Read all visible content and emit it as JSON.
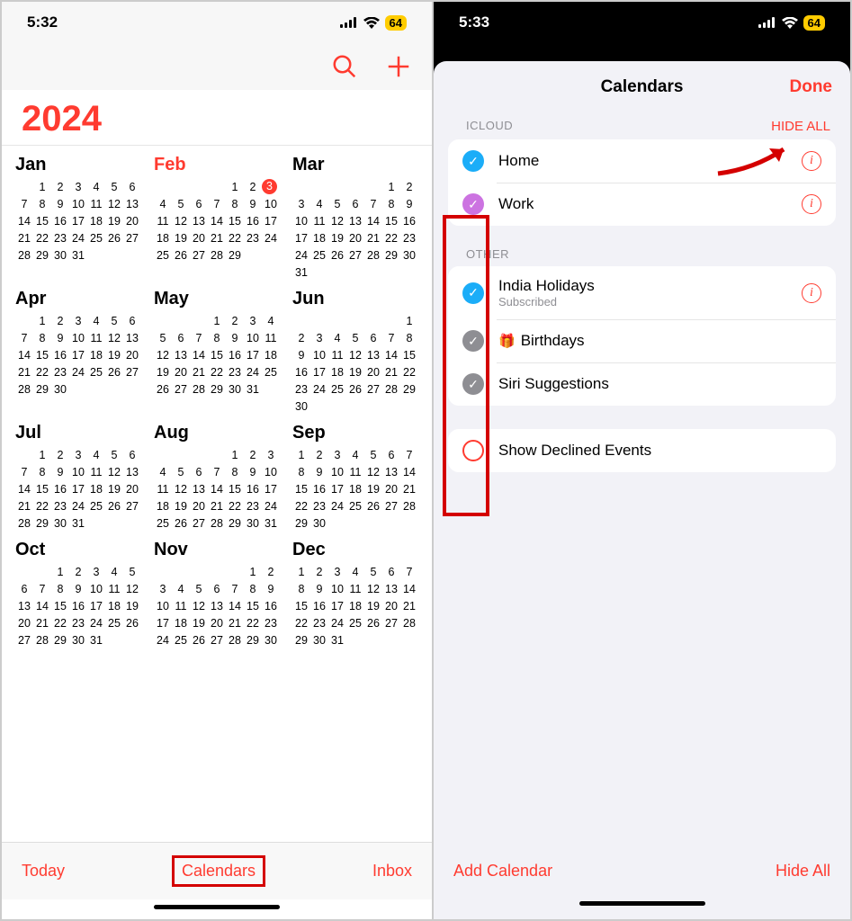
{
  "left": {
    "status": {
      "time": "5:32",
      "battery": "64"
    },
    "year": "2024",
    "months": [
      {
        "name": "Jan",
        "start": 1,
        "days": 31
      },
      {
        "name": "Feb",
        "start": 4,
        "days": 29,
        "current": true,
        "today": 3
      },
      {
        "name": "Mar",
        "start": 5,
        "days": 31
      },
      {
        "name": "Apr",
        "start": 1,
        "days": 30
      },
      {
        "name": "May",
        "start": 3,
        "days": 31
      },
      {
        "name": "Jun",
        "start": 6,
        "days": 30
      },
      {
        "name": "Jul",
        "start": 1,
        "days": 31
      },
      {
        "name": "Aug",
        "start": 4,
        "days": 31
      },
      {
        "name": "Sep",
        "start": 0,
        "days": 30
      },
      {
        "name": "Oct",
        "start": 2,
        "days": 31
      },
      {
        "name": "Nov",
        "start": 5,
        "days": 30
      },
      {
        "name": "Dec",
        "start": 0,
        "days": 31
      }
    ],
    "toolbar": {
      "today": "Today",
      "calendars": "Calendars",
      "inbox": "Inbox"
    }
  },
  "right": {
    "status": {
      "time": "5:33",
      "battery": "64"
    },
    "header": {
      "title": "Calendars",
      "done": "Done"
    },
    "sections": [
      {
        "label": "ICLOUD",
        "action": "HIDE ALL",
        "items": [
          {
            "title": "Home",
            "color": "#1badf8",
            "info": true
          },
          {
            "title": "Work",
            "color": "#cc73e1",
            "info": true
          }
        ]
      },
      {
        "label": "OTHER",
        "items": [
          {
            "title": "India Holidays",
            "sub": "Subscribed",
            "color": "#1badf8",
            "info": true
          },
          {
            "title": "Birthdays",
            "color": "#8e8e93",
            "gift": true
          },
          {
            "title": "Siri Suggestions",
            "color": "#8e8e93"
          }
        ]
      }
    ],
    "declined": {
      "label": "Show Declined Events"
    },
    "toolbar": {
      "add": "Add Calendar",
      "hideAll": "Hide All"
    }
  }
}
